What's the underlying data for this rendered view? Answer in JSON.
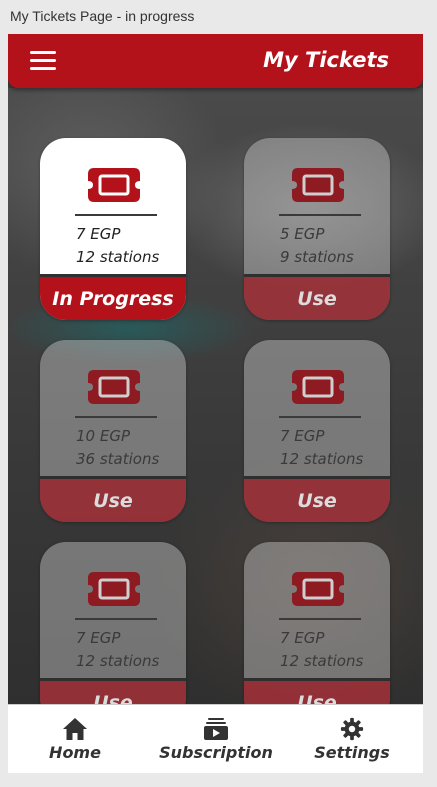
{
  "window": {
    "title": "My Tickets Page - in progress"
  },
  "header": {
    "title": "My Tickets",
    "menu_icon": "hamburger-menu-icon"
  },
  "colors": {
    "brand": "#b3121b",
    "card_active": "#ffffff",
    "card_inactive": "#c8c8c8"
  },
  "tickets": [
    {
      "price": "7 EGP",
      "stations": "12 stations",
      "action": "In Progress",
      "active": true
    },
    {
      "price": "5 EGP",
      "stations": "9 stations",
      "action": "Use",
      "active": false
    },
    {
      "price": "10 EGP",
      "stations": "36 stations",
      "action": "Use",
      "active": false
    },
    {
      "price": "7 EGP",
      "stations": "12 stations",
      "action": "Use",
      "active": false
    },
    {
      "price": "7 EGP",
      "stations": "12 stations",
      "action": "Use",
      "active": false
    },
    {
      "price": "7 EGP",
      "stations": "12 stations",
      "action": "Use",
      "active": false
    }
  ],
  "nav": {
    "items": [
      {
        "label": "Home",
        "icon": "home-icon"
      },
      {
        "label": "Subscription",
        "icon": "subscription-icon"
      },
      {
        "label": "Settings",
        "icon": "gear-icon"
      }
    ]
  }
}
